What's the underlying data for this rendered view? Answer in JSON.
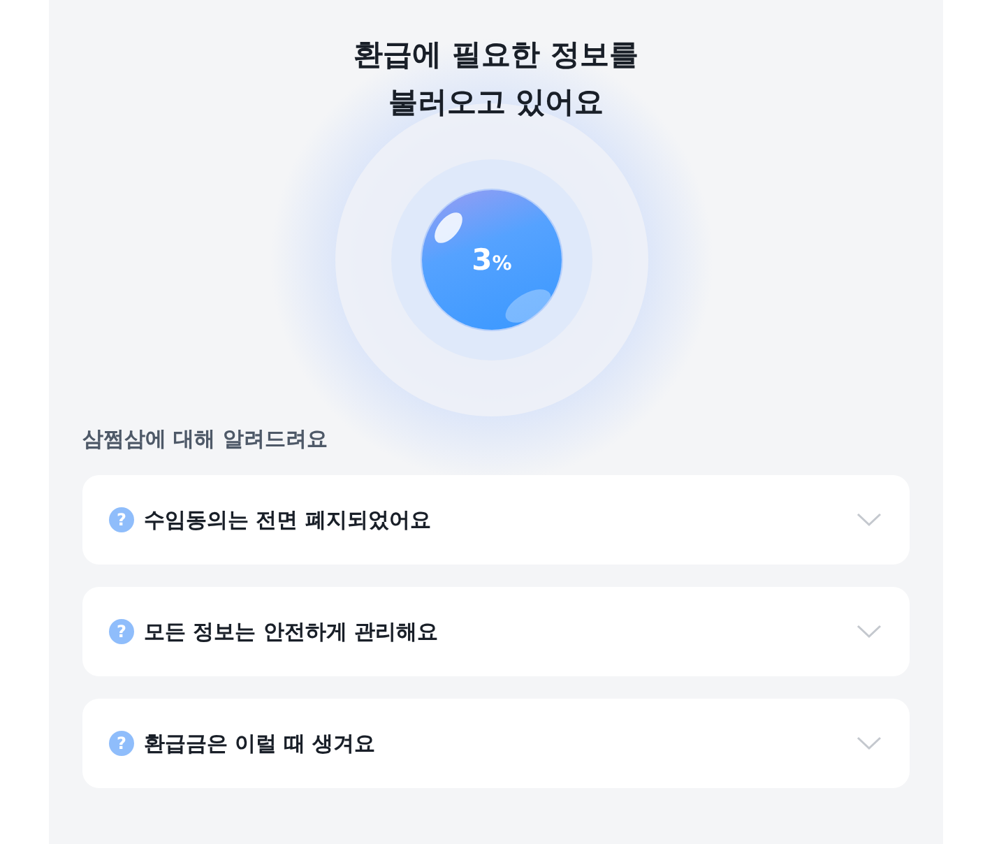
{
  "title_lines": [
    "환급에 필요한 정보를",
    "불러오고 있어요"
  ],
  "progress": {
    "value": "3",
    "unit": "%"
  },
  "section_title": "삼쩜삼에 대해 알려드려요",
  "faq": [
    {
      "icon": "?",
      "question": "수임동의는 전면 폐지되었어요",
      "expanded": false
    },
    {
      "icon": "?",
      "question": "모든 정보는 안전하게 관리해요",
      "expanded": false
    },
    {
      "icon": "?",
      "question": "환급금은 이럴 때 생겨요",
      "expanded": false
    }
  ]
}
